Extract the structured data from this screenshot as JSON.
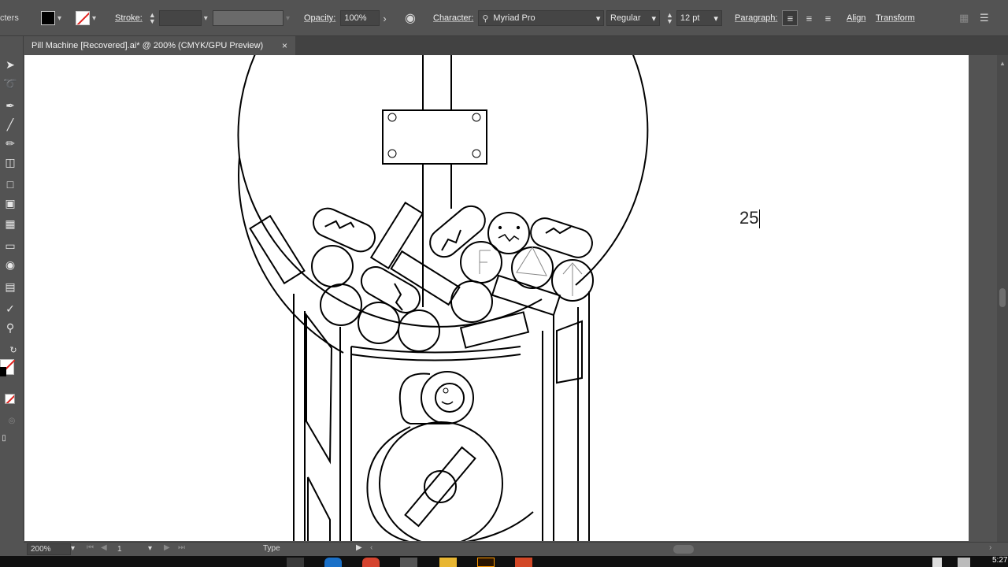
{
  "control_bar": {
    "panel_fragment": "cters",
    "stroke_label": "Stroke:",
    "opacity_label": "Opacity:",
    "opacity_value": "100%",
    "character_label": "Character:",
    "font_family": "Myriad Pro",
    "font_style": "Regular",
    "font_size": "12 pt",
    "paragraph_label": "Paragraph:",
    "align_label": "Align",
    "transform_label": "Transform"
  },
  "document": {
    "tab_title": "Pill Machine [Recovered].ai* @ 200% (CMYK/GPU Preview)",
    "close_glyph": "×"
  },
  "canvas": {
    "typed_text": "25"
  },
  "status_bar": {
    "zoom": "200%",
    "artboard_number": "1",
    "current_tool": "Type"
  },
  "taskbar": {
    "clock": "5:27"
  },
  "colors": {
    "chrome": "#535353",
    "tab_inactive": "#424242",
    "artboard": "#ffffff",
    "ink": "#000000"
  }
}
